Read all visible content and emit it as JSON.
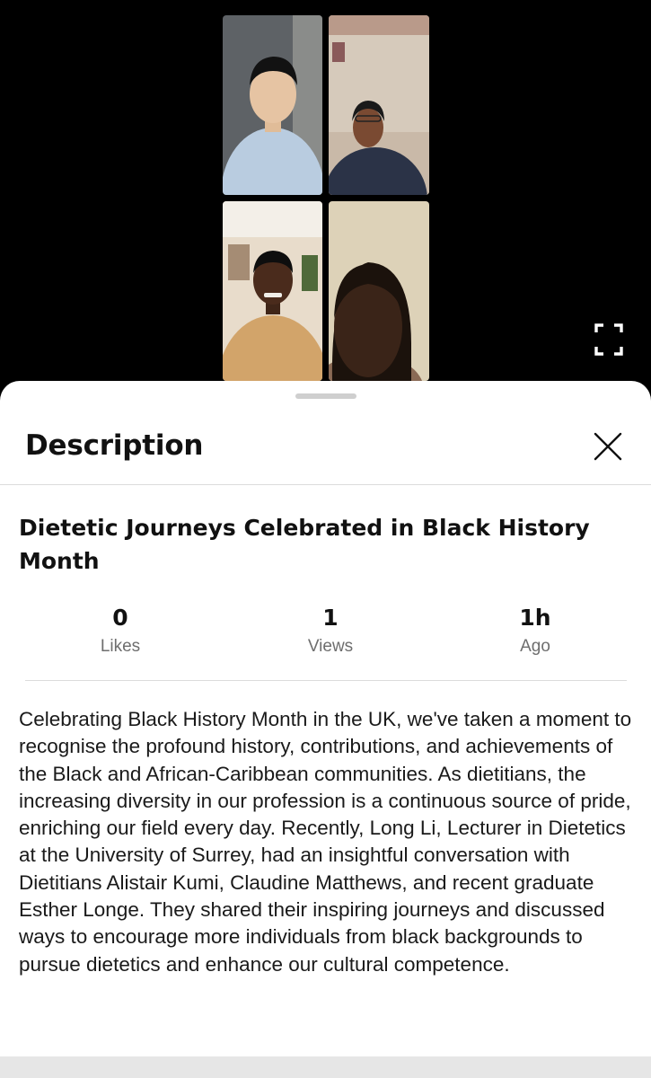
{
  "video": {
    "participants": [
      {
        "name": "participant-1",
        "bg": "#5b5f63",
        "shirt": "#b9cce0",
        "skin": "#e6c4a3",
        "hair": "#111111"
      },
      {
        "name": "participant-2",
        "bg": "#cbbfb0",
        "shirt": "#2b3347",
        "skin": "#7a4a32",
        "hair": "#1a1a1a"
      },
      {
        "name": "participant-3",
        "bg": "#e8dccb",
        "shirt": "#d2a46a",
        "skin": "#4a2b1c",
        "hair": "#0e0e0e"
      },
      {
        "name": "participant-4",
        "bg": "#d9cdb3",
        "shirt": "#8a6a55",
        "skin": "#3a2418",
        "hair": "#1b120c"
      }
    ],
    "fullscreen_icon": "fullscreen-icon"
  },
  "sheet": {
    "title": "Description",
    "close_icon": "close-icon"
  },
  "post": {
    "title": "Dietetic Journeys Celebrated in Black History Month",
    "stats": [
      {
        "value": "0",
        "label": "Likes"
      },
      {
        "value": "1",
        "label": "Views"
      },
      {
        "value": "1h",
        "label": "Ago"
      }
    ],
    "description": "Celebrating Black History Month in the UK, we've taken a moment to recognise the profound history, contributions, and achievements of the Black and African-Caribbean communities. As dietitians, the increasing diversity in our profession is a continuous source of pride, enriching our field every day. Recently, Long Li, Lecturer in Dietetics at the University of Surrey, had an insightful conversation with Dietitians Alistair Kumi, Claudine Matthews, and recent graduate Esther Longe. They shared their inspiring journeys and discussed ways to encourage more individuals from black backgrounds to pursue dietetics and enhance our cultural competence."
  },
  "colors": {
    "background": "#000000",
    "sheet": "#ffffff",
    "text": "#111111",
    "muted": "#6e6e6e"
  }
}
